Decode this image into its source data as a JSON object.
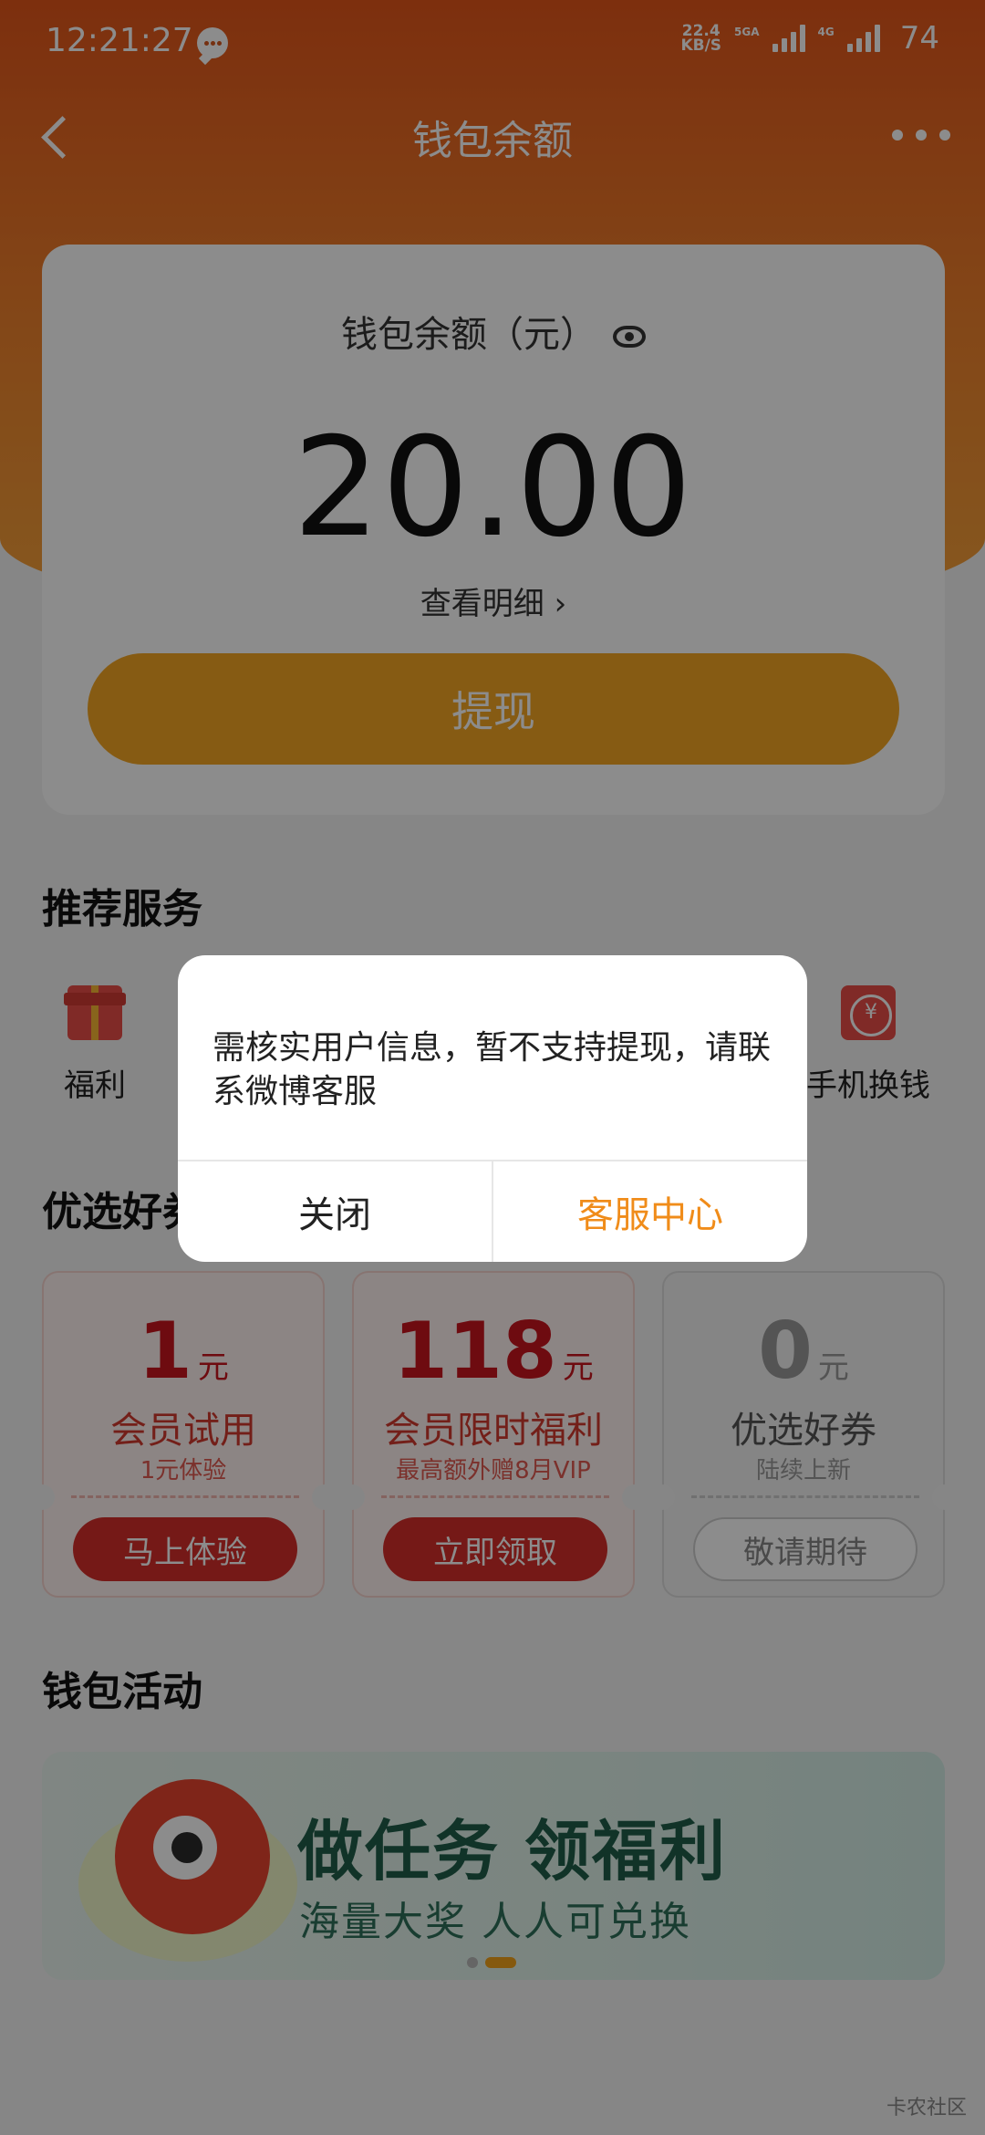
{
  "status_bar": {
    "time": "12:21:27",
    "net_speed_value": "22.4",
    "net_speed_unit": "KB/S",
    "sig1_label": "5GA",
    "sig2_label": "4G",
    "battery": "74"
  },
  "nav": {
    "title": "钱包余额"
  },
  "balance": {
    "label": "钱包余额（元）",
    "amount": "20.00",
    "detail_link": "查看明细 ›",
    "withdraw_button": "提现"
  },
  "services": {
    "title": "推荐服务",
    "items": [
      {
        "label": "福利",
        "icon": "gift-icon"
      },
      {
        "label": "手机换钱",
        "icon": "phone-exchange-icon"
      }
    ]
  },
  "coupons": {
    "title": "优选好券",
    "items": [
      {
        "amount": "1",
        "unit": "元",
        "title": "会员试用",
        "subtitle": "1元体验",
        "button": "马上体验"
      },
      {
        "amount": "118",
        "unit": "元",
        "title": "会员限时福利",
        "subtitle": "最高额外赠8月VIP",
        "button": "立即领取"
      },
      {
        "amount": "0",
        "unit": "元",
        "title": "优选好券",
        "subtitle": "陆续上新",
        "button": "敬请期待"
      }
    ]
  },
  "activity": {
    "title": "钱包活动",
    "banner_title": "做任务 领福利",
    "banner_subtitle": "海量大奖 人人可兑换",
    "carousel_active_index": 1
  },
  "watermark": "卡农社区",
  "dialog": {
    "message": "需核实用户信息，暂不支持提现，请联系微博客服",
    "close_button": "关闭",
    "service_button": "客服中心"
  },
  "colors": {
    "header_gradient_start": "#e3561b",
    "withdraw_button": "#f5a623",
    "coupon_red": "#c9151e",
    "dialog_accent": "#f08c1a"
  }
}
